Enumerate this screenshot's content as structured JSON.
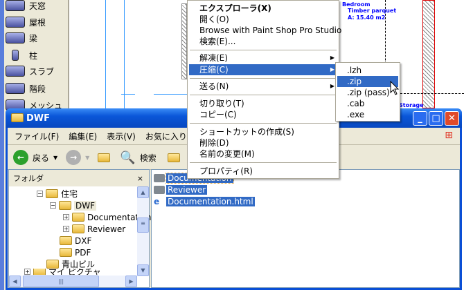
{
  "palette": {
    "items": [
      {
        "label": "天窓",
        "icon": "skylight-icon"
      },
      {
        "label": "屋根",
        "icon": "roof-icon"
      },
      {
        "label": "梁",
        "icon": "beam-icon"
      },
      {
        "label": "柱",
        "icon": "column-icon"
      },
      {
        "label": "スラブ",
        "icon": "slab-icon"
      },
      {
        "label": "階段",
        "icon": "stairs-icon"
      },
      {
        "label": "メッシュ",
        "icon": "mesh-icon"
      }
    ]
  },
  "cad": {
    "room1": "Bedroom",
    "room1_floor": "Timber parquet",
    "room1_area": "A: 15.40 m2",
    "room2": "Storage"
  },
  "window": {
    "title": "DWF",
    "menu": [
      "ファイル(F)",
      "編集(E)",
      "表示(V)",
      "お気に入り(A)"
    ],
    "toolbar": {
      "back": "戻る",
      "search": "検索"
    },
    "folder_pane": {
      "title": "フォルダ",
      "close": "×",
      "tree": [
        {
          "label": "住宅",
          "expander": "−"
        },
        {
          "label": "DWF",
          "expander": "−"
        },
        {
          "label": "Documentation",
          "expander": "+"
        },
        {
          "label": "Reviewer",
          "expander": "+"
        },
        {
          "label": "DXF"
        },
        {
          "label": "PDF"
        },
        {
          "label": "青山ビル"
        },
        {
          "label": "マイ ピクチャ"
        }
      ]
    },
    "files": [
      {
        "name": "Documentation",
        "type": "folder"
      },
      {
        "name": "Reviewer",
        "type": "folder"
      },
      {
        "name": "Documentation.html",
        "type": "html"
      }
    ]
  },
  "context_menu": {
    "items": [
      "エクスプローラ(X)",
      "開く(O)",
      "Browse with Paint Shop Pro Studio",
      "検索(E)...",
      "解凍(E)",
      "圧縮(C)",
      "送る(N)",
      "切り取り(T)",
      "コピー(C)",
      "ショートカットの作成(S)",
      "削除(D)",
      "名前の変更(M)",
      "プロパティ(R)"
    ]
  },
  "submenu": {
    "items": [
      ".lzh",
      ".zip",
      ".zip (pass)",
      ".cab",
      ".exe"
    ]
  }
}
